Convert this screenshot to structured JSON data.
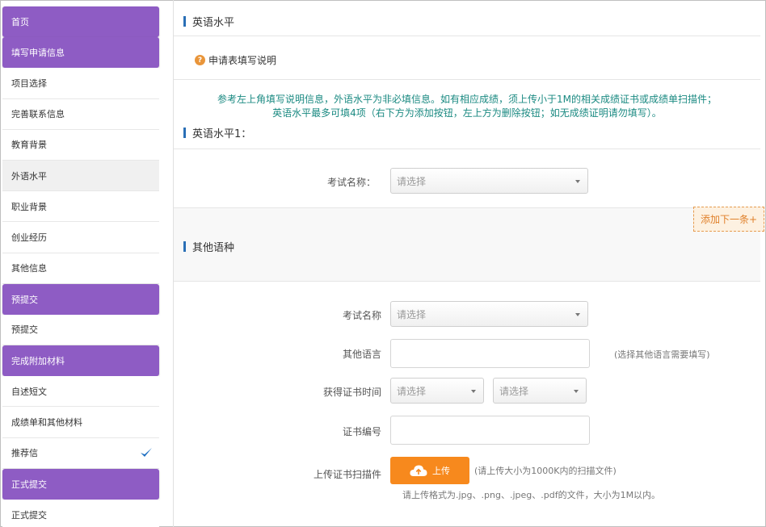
{
  "sidebar": {
    "items": [
      {
        "label": "首页",
        "type": "group"
      },
      {
        "label": "填写申请信息",
        "type": "group"
      },
      {
        "label": "项目选择",
        "type": "link"
      },
      {
        "label": "完善联系信息",
        "type": "link"
      },
      {
        "label": "教育背景",
        "type": "link"
      },
      {
        "label": "外语水平",
        "type": "link",
        "active": true
      },
      {
        "label": "职业背景",
        "type": "link"
      },
      {
        "label": "创业经历",
        "type": "link"
      },
      {
        "label": "其他信息",
        "type": "link"
      },
      {
        "label": "预提交",
        "type": "group"
      },
      {
        "label": "预提交",
        "type": "link"
      },
      {
        "label": "完成附加材料",
        "type": "group"
      },
      {
        "label": "自述短文",
        "type": "link"
      },
      {
        "label": "成绩单和其他材料",
        "type": "link"
      },
      {
        "label": "推荐信",
        "type": "link",
        "checked": true
      },
      {
        "label": "正式提交",
        "type": "group"
      },
      {
        "label": "正式提交",
        "type": "link"
      }
    ]
  },
  "main": {
    "english_title": "英语水平",
    "help_title": "申请表填写说明",
    "notice_line1": "参考左上角填写说明信息，外语水平为非必填信息。如有相应成绩，须上传小于1M的相关成绩证书或成绩单扫描件；",
    "notice_line2": "英语水平最多可填4项（右下方为添加按钮，左上方为删除按钮；如无成绩证明请勿填写）。",
    "english1_title": "英语水平1：",
    "exam_name_label": "考试名称：",
    "select_placeholder": "请选择",
    "add_next_label": "添加下一条+",
    "other_lang_title": "其他语种",
    "other_exam_label": "考试名称",
    "other_language_label": "其他语言",
    "other_language_hint": "(选择其他语言需要填写)",
    "cert_time_label": "获得证书时间",
    "cert_no_label": "证书编号",
    "upload_label": "上传证书扫描件",
    "upload_button": "上传",
    "upload_hint": "(请上传大小为1000K内的扫描文件)",
    "upload_format": "请上传格式为.jpg、.png、.jpeg、.pdf的文件，大小为1M以内。"
  },
  "colors": {
    "sidebar_group": "#8e5cc4",
    "accent_bar": "#2a6fb6",
    "notice_text": "#1b8a82",
    "upload_button": "#f7891d",
    "add_button_text": "#e0802a",
    "check_mark": "#1e6fc2"
  }
}
